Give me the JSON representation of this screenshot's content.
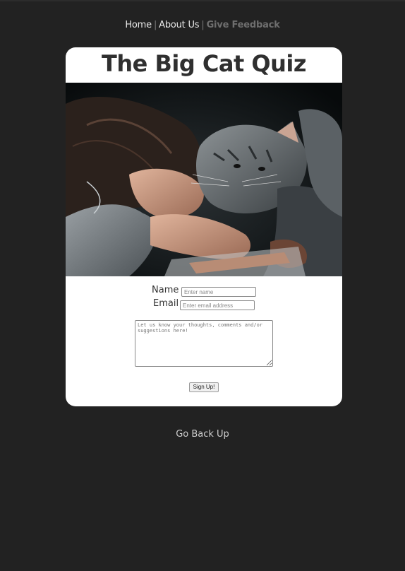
{
  "nav": {
    "items": [
      {
        "label": "Home"
      },
      {
        "label": "About Us"
      },
      {
        "label": "Give Feedback"
      }
    ],
    "separator": "|"
  },
  "card": {
    "title": "The Big Cat Quiz",
    "image": "girl-with-cat-photo"
  },
  "form": {
    "name_label": "Name",
    "name_placeholder": "Enter name",
    "email_label": "Email",
    "email_placeholder": "Enter email address",
    "comments_placeholder": "Let us know your thoughts, comments and/or suggestions here!",
    "submit_label": "Sign Up!"
  },
  "footer": {
    "back_up_label": "Go Back Up"
  },
  "colors": {
    "page_background": "#222222",
    "card_background": "#ffffff",
    "active_nav": "#6e6e6e"
  }
}
